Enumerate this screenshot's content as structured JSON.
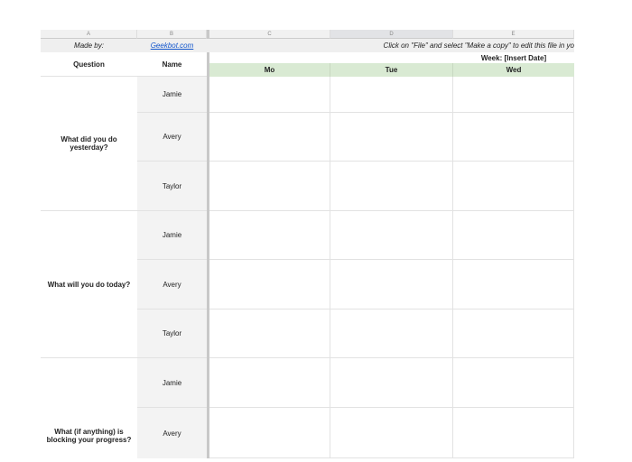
{
  "columns": [
    "A",
    "B",
    "C",
    "D",
    "E"
  ],
  "made_by_label": "Made by:",
  "made_by_link": "Geekbot.com",
  "notice": "Click on \"File\" and select \"Make a copy\" to edit this file in yo",
  "week_label": "Week: [Insert Date]",
  "headers": {
    "question": "Question",
    "name": "Name"
  },
  "days": [
    "Mo",
    "Tue",
    "Wed"
  ],
  "groups": [
    {
      "question": "What did you do yesterday?",
      "names": [
        "Jamie",
        "Avery",
        "Taylor"
      ]
    },
    {
      "question": "What will you do today?",
      "names": [
        "Jamie",
        "Avery",
        "Taylor"
      ]
    },
    {
      "question": "What (if anything) is blocking your progress?",
      "names": [
        "Jamie",
        "Avery"
      ]
    }
  ],
  "colors": {
    "day_header": "#d9ead3",
    "name_col": "#f3f3f3",
    "link": "#1155cc"
  }
}
